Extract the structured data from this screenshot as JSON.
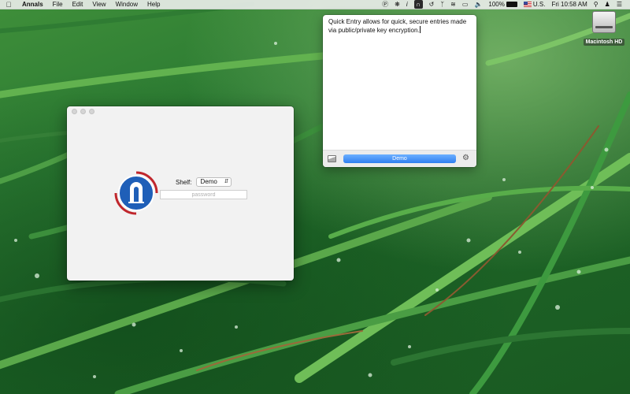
{
  "menubar": {
    "apple_icon": "apple-logo-icon",
    "app_name": "Annals",
    "menus": [
      "File",
      "Edit",
      "View",
      "Window",
      "Help"
    ],
    "status": {
      "input_source": "U.S.",
      "battery": "100%",
      "clock": "Fri 10:58 AM"
    }
  },
  "desktop": {
    "disk_label": "Macintosh HD"
  },
  "main_window": {
    "shelf_label": "Shelf:",
    "shelf_value": "Demo",
    "password_placeholder": "password"
  },
  "quick_entry": {
    "text": "Quick Entry allows for quick, secure entries made via public/private key encryption.",
    "shelf_button": "Demo"
  },
  "colors": {
    "accent_blue": "#2f7ff0",
    "logo_blue": "#1f5fb8",
    "logo_red": "#c0272d"
  }
}
